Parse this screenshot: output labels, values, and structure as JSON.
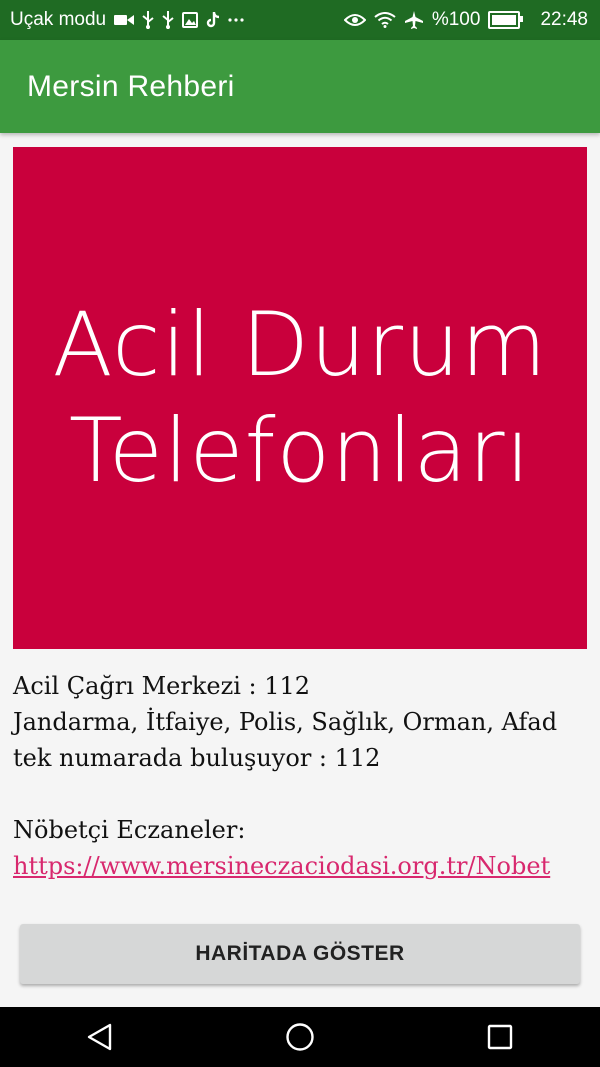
{
  "status_bar": {
    "left_text": "Uçak modu",
    "battery_text": "%100",
    "time": "22:48",
    "icons_left": [
      "video-icon",
      "usb-icon",
      "usb-icon",
      "image-icon",
      "tiktok-icon",
      "more-icon"
    ],
    "icons_right": [
      "eye-icon",
      "wifi-icon",
      "airplane-icon",
      "battery-icon"
    ]
  },
  "app_bar": {
    "title": "Mersin Rehberi"
  },
  "banner": {
    "line1": "Acil Durum",
    "line2": "Telefonları",
    "bg_color": "#c9003c"
  },
  "info": {
    "line1": "Acil Çağrı Merkezi : 112",
    "line2": "Jandarma, İtfaiye, Polis, Sağlık, Orman, Afad",
    "line3": "tek numarada buluşuyor : 112",
    "pharmacy_label": "Nöbetçi Eczaneler:",
    "pharmacy_link": "https://www.mersineczaciodasi.org.tr/Nobet"
  },
  "button": {
    "label": "HARİTADA GÖSTER"
  },
  "colors": {
    "status_bar": "#1f6b23",
    "app_bar": "#3d9a3f",
    "link": "#d8286e"
  }
}
